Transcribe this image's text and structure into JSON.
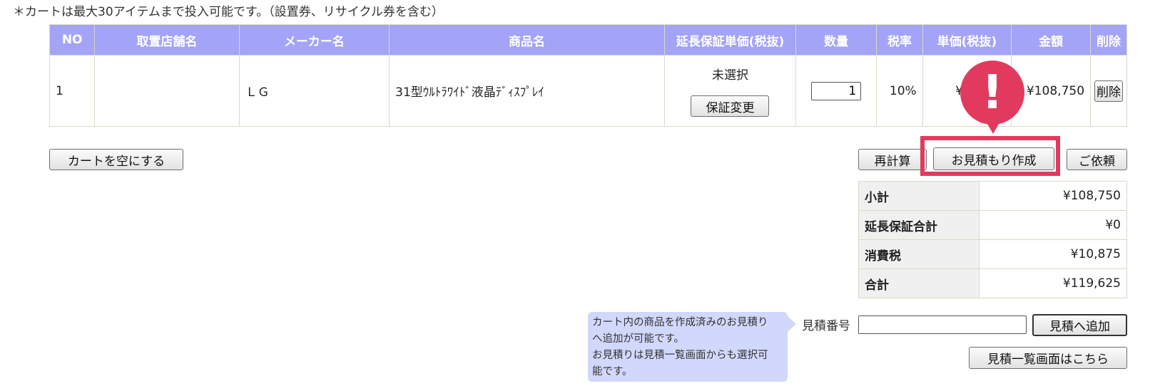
{
  "notice": "＊カートは最大30アイテムまで投入可能です。（設置券、リサイクル券を含む）",
  "table": {
    "headers": [
      "NO",
      "取置店舗名",
      "メーカー名",
      "商品名",
      "延長保証単価(税抜)",
      "数量",
      "税率",
      "単価(税抜)",
      "金額",
      "削除"
    ],
    "rows": [
      {
        "no": "1",
        "shop": "",
        "maker": "ＬＧ",
        "product": "31型ｳﾙﾄﾗﾜｲﾄﾞ液晶ﾃﾞｨｽﾌﾟﾚｲ",
        "warranty_status": "未選択",
        "warranty_button": "保証変更",
        "qty": "1",
        "tax_rate": "10%",
        "unit_price": "¥10",
        "amount": "¥108,750",
        "delete_button": "削除"
      }
    ]
  },
  "buttons": {
    "empty_cart": "カートを空にする",
    "recalc": "再計算",
    "create_estimate": "お見積もり作成",
    "request": "ご依頼",
    "add_to_estimate": "見積へ追加",
    "estimate_list": "見積一覧画面はこちら"
  },
  "summary": [
    {
      "label": "小計",
      "value": "¥108,750"
    },
    {
      "label": "延長保証合計",
      "value": "¥0"
    },
    {
      "label": "消費税",
      "value": "¥10,875"
    },
    {
      "label": "合計",
      "value": "¥119,625"
    }
  ],
  "estimate": {
    "label": "見積番号",
    "input_value": ""
  },
  "tooltip": {
    "line1": "カート内の商品を作成済みのお見積り",
    "line2": "へ追加が可能です。",
    "line3": "お見積りは見積一覧画面からも選択可",
    "line4": "能です。"
  },
  "marker": {
    "symbol": "!"
  },
  "colors": {
    "header_bg": "#a3a3f7",
    "highlight": "#e23a5e",
    "tooltip_bg": "#d2d8fb"
  }
}
